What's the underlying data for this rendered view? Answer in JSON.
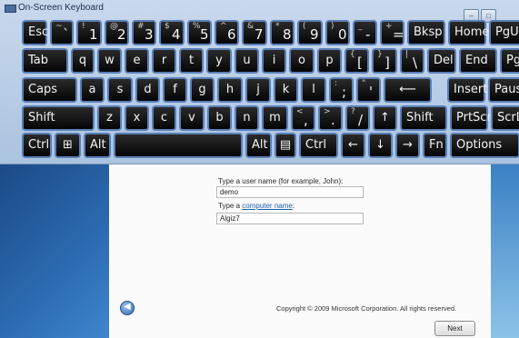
{
  "window": {
    "title": "On-Screen Keyboard",
    "min": "–",
    "max": "□"
  },
  "keys": {
    "r1": [
      {
        "main": "Esc"
      },
      {
        "main": "`",
        "sub": "~"
      },
      {
        "main": "1",
        "sub": "!"
      },
      {
        "main": "2",
        "sub": "@"
      },
      {
        "main": "3",
        "sub": "#"
      },
      {
        "main": "4",
        "sub": "$"
      },
      {
        "main": "5",
        "sub": "%"
      },
      {
        "main": "6",
        "sub": "^"
      },
      {
        "main": "7",
        "sub": "&"
      },
      {
        "main": "8",
        "sub": "*"
      },
      {
        "main": "9",
        "sub": "("
      },
      {
        "main": "0",
        "sub": ")"
      },
      {
        "main": "-",
        "sub": "_"
      },
      {
        "main": "=",
        "sub": "+"
      },
      {
        "main": "Bksp"
      },
      {
        "main": "Home"
      },
      {
        "main": "PgUp"
      }
    ],
    "r2": [
      {
        "main": "Tab"
      },
      {
        "main": "q"
      },
      {
        "main": "w"
      },
      {
        "main": "e"
      },
      {
        "main": "r"
      },
      {
        "main": "t"
      },
      {
        "main": "y"
      },
      {
        "main": "u"
      },
      {
        "main": "i"
      },
      {
        "main": "o"
      },
      {
        "main": "p"
      },
      {
        "main": "[",
        "sub": "{"
      },
      {
        "main": "]",
        "sub": "}"
      },
      {
        "main": "\\",
        "sub": "|"
      },
      {
        "main": "Del"
      },
      {
        "main": "End"
      },
      {
        "main": "PgDn"
      }
    ],
    "r3": [
      {
        "main": "Caps"
      },
      {
        "main": "a"
      },
      {
        "main": "s"
      },
      {
        "main": "d"
      },
      {
        "main": "f"
      },
      {
        "main": "g"
      },
      {
        "main": "h"
      },
      {
        "main": "j"
      },
      {
        "main": "k"
      },
      {
        "main": "l"
      },
      {
        "main": ";",
        "sub": ":"
      },
      {
        "main": "'",
        "sub": "\""
      },
      {
        "main": "⟵"
      },
      {
        "main": "Insert"
      },
      {
        "main": "Pause"
      }
    ],
    "r4": [
      {
        "main": "Shift"
      },
      {
        "main": "z"
      },
      {
        "main": "x"
      },
      {
        "main": "c"
      },
      {
        "main": "v"
      },
      {
        "main": "b"
      },
      {
        "main": "n"
      },
      {
        "main": "m"
      },
      {
        "main": ",",
        "sub": "<"
      },
      {
        "main": ".",
        "sub": ">"
      },
      {
        "main": "/",
        "sub": "?"
      },
      {
        "main": "↑"
      },
      {
        "main": "Shift"
      },
      {
        "main": "PrtScn"
      },
      {
        "main": "ScrLk"
      }
    ],
    "r5": [
      {
        "main": "Ctrl"
      },
      {
        "main": "⊞"
      },
      {
        "main": "Alt"
      },
      {
        "main": ""
      },
      {
        "main": "Alt"
      },
      {
        "main": "▤"
      },
      {
        "main": "Ctrl"
      },
      {
        "main": "←"
      },
      {
        "main": "↓"
      },
      {
        "main": "→"
      },
      {
        "main": "Fn"
      },
      {
        "main": "Options"
      }
    ]
  },
  "setup": {
    "username_label": "Type a user name (for example, John):",
    "username_value": "demo",
    "computer_label_prefix": "Type a",
    "computer_label_link": "computer name",
    "computer_label_suffix": ":",
    "computer_value": "Algiz7",
    "copyright": "Copyright © 2009 Microsoft Corporation.  All rights reserved.",
    "next_label": "Next"
  }
}
